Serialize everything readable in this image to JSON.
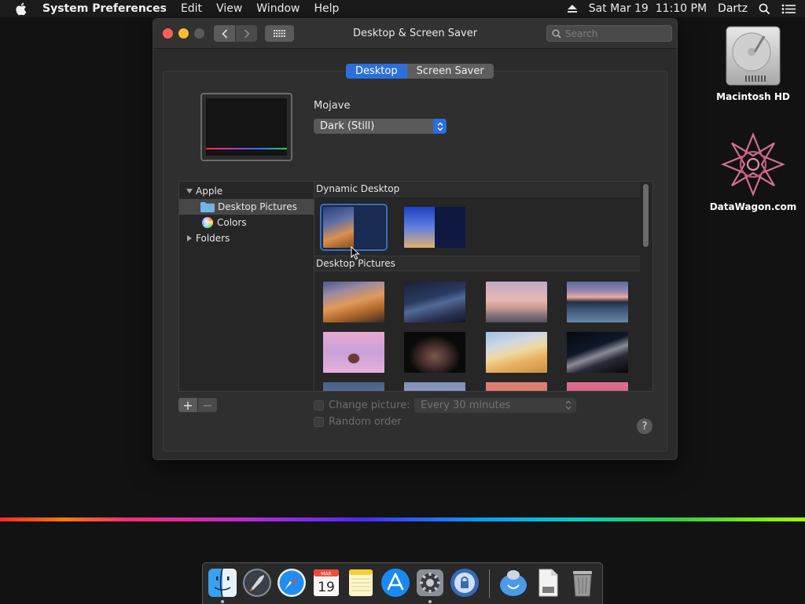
{
  "menubar": {
    "app_name": "System Preferences",
    "items": [
      "Edit",
      "View",
      "Window",
      "Help"
    ],
    "datetime": "Sat Mar 19  11:10 PM",
    "user": "Dartz"
  },
  "desktop": {
    "icons": [
      {
        "label": "Macintosh HD"
      },
      {
        "label": "DataWagon.com"
      }
    ]
  },
  "window": {
    "title": "Desktop & Screen Saver",
    "search_placeholder": "Search",
    "tabs": [
      {
        "label": "Desktop",
        "active": true
      },
      {
        "label": "Screen Saver",
        "active": false
      }
    ],
    "wallpaper_name": "Mojave",
    "appearance_value": "Dark (Still)",
    "sources": {
      "apple_group": "Apple",
      "desktop_pictures": "Desktop Pictures",
      "colors": "Colors",
      "folders": "Folders"
    },
    "sections": {
      "dynamic": "Dynamic Desktop",
      "pictures": "Desktop Pictures"
    },
    "change_picture_label": "Change picture:",
    "interval_value": "Every 30 minutes",
    "random_order_label": "Random order",
    "help_label": "?",
    "plus_label": "+",
    "minus_label": "−"
  },
  "dock": {
    "calendar_month": "MAR",
    "calendar_day": "19"
  },
  "colors": {
    "accent": "#2a6fdb",
    "close": "#fd5f57",
    "minimize": "#fdbb2d"
  }
}
